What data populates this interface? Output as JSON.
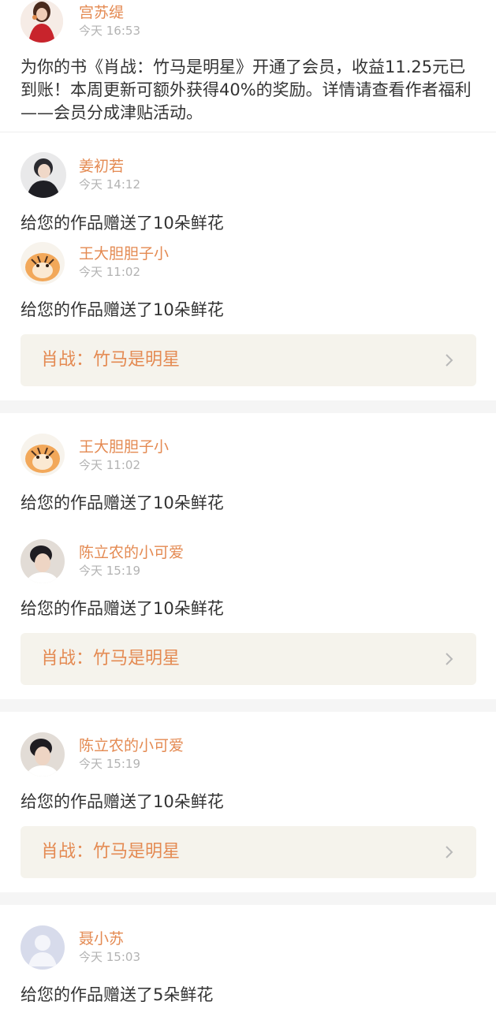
{
  "entries": [
    {
      "name": "宫苏缇",
      "time": "今天 16:53",
      "avatar": "girl-red-dress-avatar",
      "message": "为你的书《肖战：竹马是明星》开通了会员，收益11.25元已到账！本周更新可额外获得40%的奖励。详情请查看作者福利——会员分成津贴活动。"
    },
    {
      "name": "姜初若",
      "time": "今天 14:12",
      "avatar": "young-man-photo-avatar",
      "message": "给您的作品赠送了10朵鲜花"
    },
    {
      "name": "王大胆胆子小",
      "time": "今天 11:02",
      "avatar": "chubby-tiger-avatar",
      "message": "给您的作品赠送了10朵鲜花"
    },
    {
      "name": "王大胆胆子小",
      "time": "今天 11:02",
      "avatar": "chubby-tiger-avatar",
      "message": "给您的作品赠送了10朵鲜花"
    },
    {
      "name": "陈立农的小可爱",
      "time": "今天 15:19",
      "avatar": "young-man-photo-avatar",
      "message": "给您的作品赠送了10朵鲜花"
    },
    {
      "name": "陈立农的小可爱",
      "time": "今天 15:19",
      "avatar": "young-man-photo-avatar",
      "message": "给您的作品赠送了10朵鲜花"
    },
    {
      "name": "聂小苏",
      "time": "今天 15:03",
      "avatar": "default-user-avatar",
      "message": "给您的作品赠送了5朵鲜花"
    }
  ],
  "book_cards": [
    {
      "title": "肖战：竹马是明星"
    },
    {
      "title": "肖战：竹马是明星"
    },
    {
      "title": "肖战：竹马是明星"
    }
  ],
  "colors": {
    "name": "#e48a52",
    "time": "#b3b3b3",
    "text": "#333333",
    "card_bg": "#f5f3ec",
    "separator": "#f5f5f5"
  },
  "icons": {
    "chevron": "chevron-right-icon"
  }
}
